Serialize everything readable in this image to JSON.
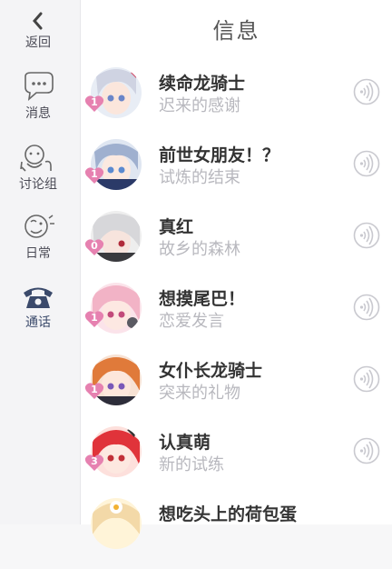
{
  "title": "信息",
  "sidebar": {
    "items": [
      {
        "label": "返回",
        "icon": "back-icon"
      },
      {
        "label": "消息",
        "icon": "message-icon"
      },
      {
        "label": "讨论组",
        "icon": "group-chat-icon"
      },
      {
        "label": "日常",
        "icon": "daily-icon"
      },
      {
        "label": "通话",
        "icon": "phone-icon",
        "active": true
      }
    ]
  },
  "calls": [
    {
      "name": "续命龙骑士",
      "subtitle": "迟来的感谢",
      "badge": "1"
    },
    {
      "name": "前世女朋友！？",
      "subtitle": "试炼的结束",
      "badge": "1"
    },
    {
      "name": "真红",
      "subtitle": "故乡的森林",
      "badge": "0"
    },
    {
      "name": "想摸尾巴！",
      "subtitle": "恋爱发言",
      "badge": "1"
    },
    {
      "name": "女仆长龙骑士",
      "subtitle": "突来的礼物",
      "badge": "1"
    },
    {
      "name": "认真萌",
      "subtitle": "新的试练",
      "badge": "3"
    },
    {
      "name": "想吃头上的荷包蛋",
      "subtitle": "",
      "badge": ""
    }
  ],
  "colors": {
    "accent": "#3b4a6b",
    "badge": "#e681b0",
    "muted": "#b8b8be"
  }
}
